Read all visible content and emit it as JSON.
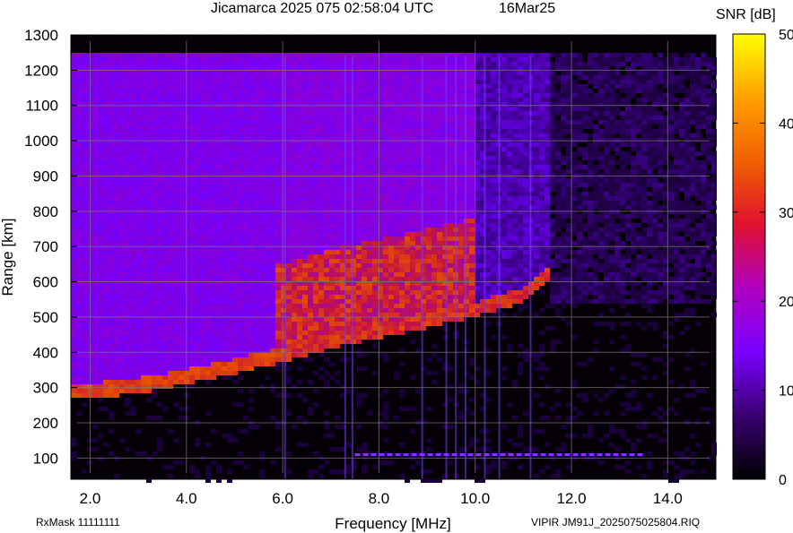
{
  "chart_data": {
    "type": "heatmap",
    "title": "Jicamarca 2025 075 02:58:04 UTC",
    "date": "16Mar25",
    "xlabel": "Frequency [MHz]",
    "ylabel": "Range [km]",
    "xlim": [
      1.6,
      15.0
    ],
    "ylim": [
      40,
      1300
    ],
    "x_ticks": [
      "2.0",
      "4.0",
      "6.0",
      "8.0",
      "10.0",
      "12.0",
      "14.0"
    ],
    "x_tick_values": [
      2,
      4,
      6,
      8,
      10,
      12,
      14
    ],
    "y_ticks": [
      "100",
      "200",
      "300",
      "400",
      "500",
      "600",
      "700",
      "800",
      "900",
      "1000",
      "1100",
      "1200",
      "1300"
    ],
    "y_tick_values": [
      100,
      200,
      300,
      400,
      500,
      600,
      700,
      800,
      900,
      1000,
      1100,
      1200,
      1300
    ],
    "colorbar": {
      "label": "SNR [dB]",
      "range": [
        0,
        50
      ],
      "ticks": [
        "0",
        "10",
        "20",
        "30",
        "40",
        "50"
      ],
      "tick_values": [
        0,
        10,
        20,
        30,
        40,
        50
      ],
      "colors": [
        "#000000",
        "#3a0070",
        "#7a00ff",
        "#b000c0",
        "#e01030",
        "#f06000",
        "#ffa000",
        "#ffff00"
      ]
    },
    "grid": true,
    "echo_traces": [
      {
        "desc": "o-trace",
        "points": [
          [
            1.6,
            290
          ],
          [
            2.5,
            295
          ],
          [
            3.5,
            315
          ],
          [
            4.5,
            345
          ],
          [
            5.5,
            375
          ],
          [
            6.1,
            395
          ],
          [
            6.3,
            405
          ],
          [
            7,
            430
          ],
          [
            8,
            460
          ],
          [
            9,
            490
          ],
          [
            10,
            520
          ],
          [
            11,
            560
          ],
          [
            11.5,
            620
          ]
        ]
      },
      {
        "desc": "x-trace",
        "points": [
          [
            4.8,
            445
          ],
          [
            5.5,
            435
          ],
          [
            6,
            470
          ],
          [
            6.5,
            540
          ],
          [
            7,
            600
          ],
          [
            7.5,
            650
          ],
          [
            8,
            690
          ],
          [
            9,
            730
          ]
        ]
      }
    ],
    "interference_lines_mhz": [
      6.05,
      7.3,
      7.45,
      8.9,
      9.4,
      9.6,
      9.8,
      10.2,
      10.5,
      11.15
    ]
  },
  "footer": {
    "left": "RxMask 11111111",
    "right": "VIPIR  JM91J_2025075025804.RIQ"
  }
}
